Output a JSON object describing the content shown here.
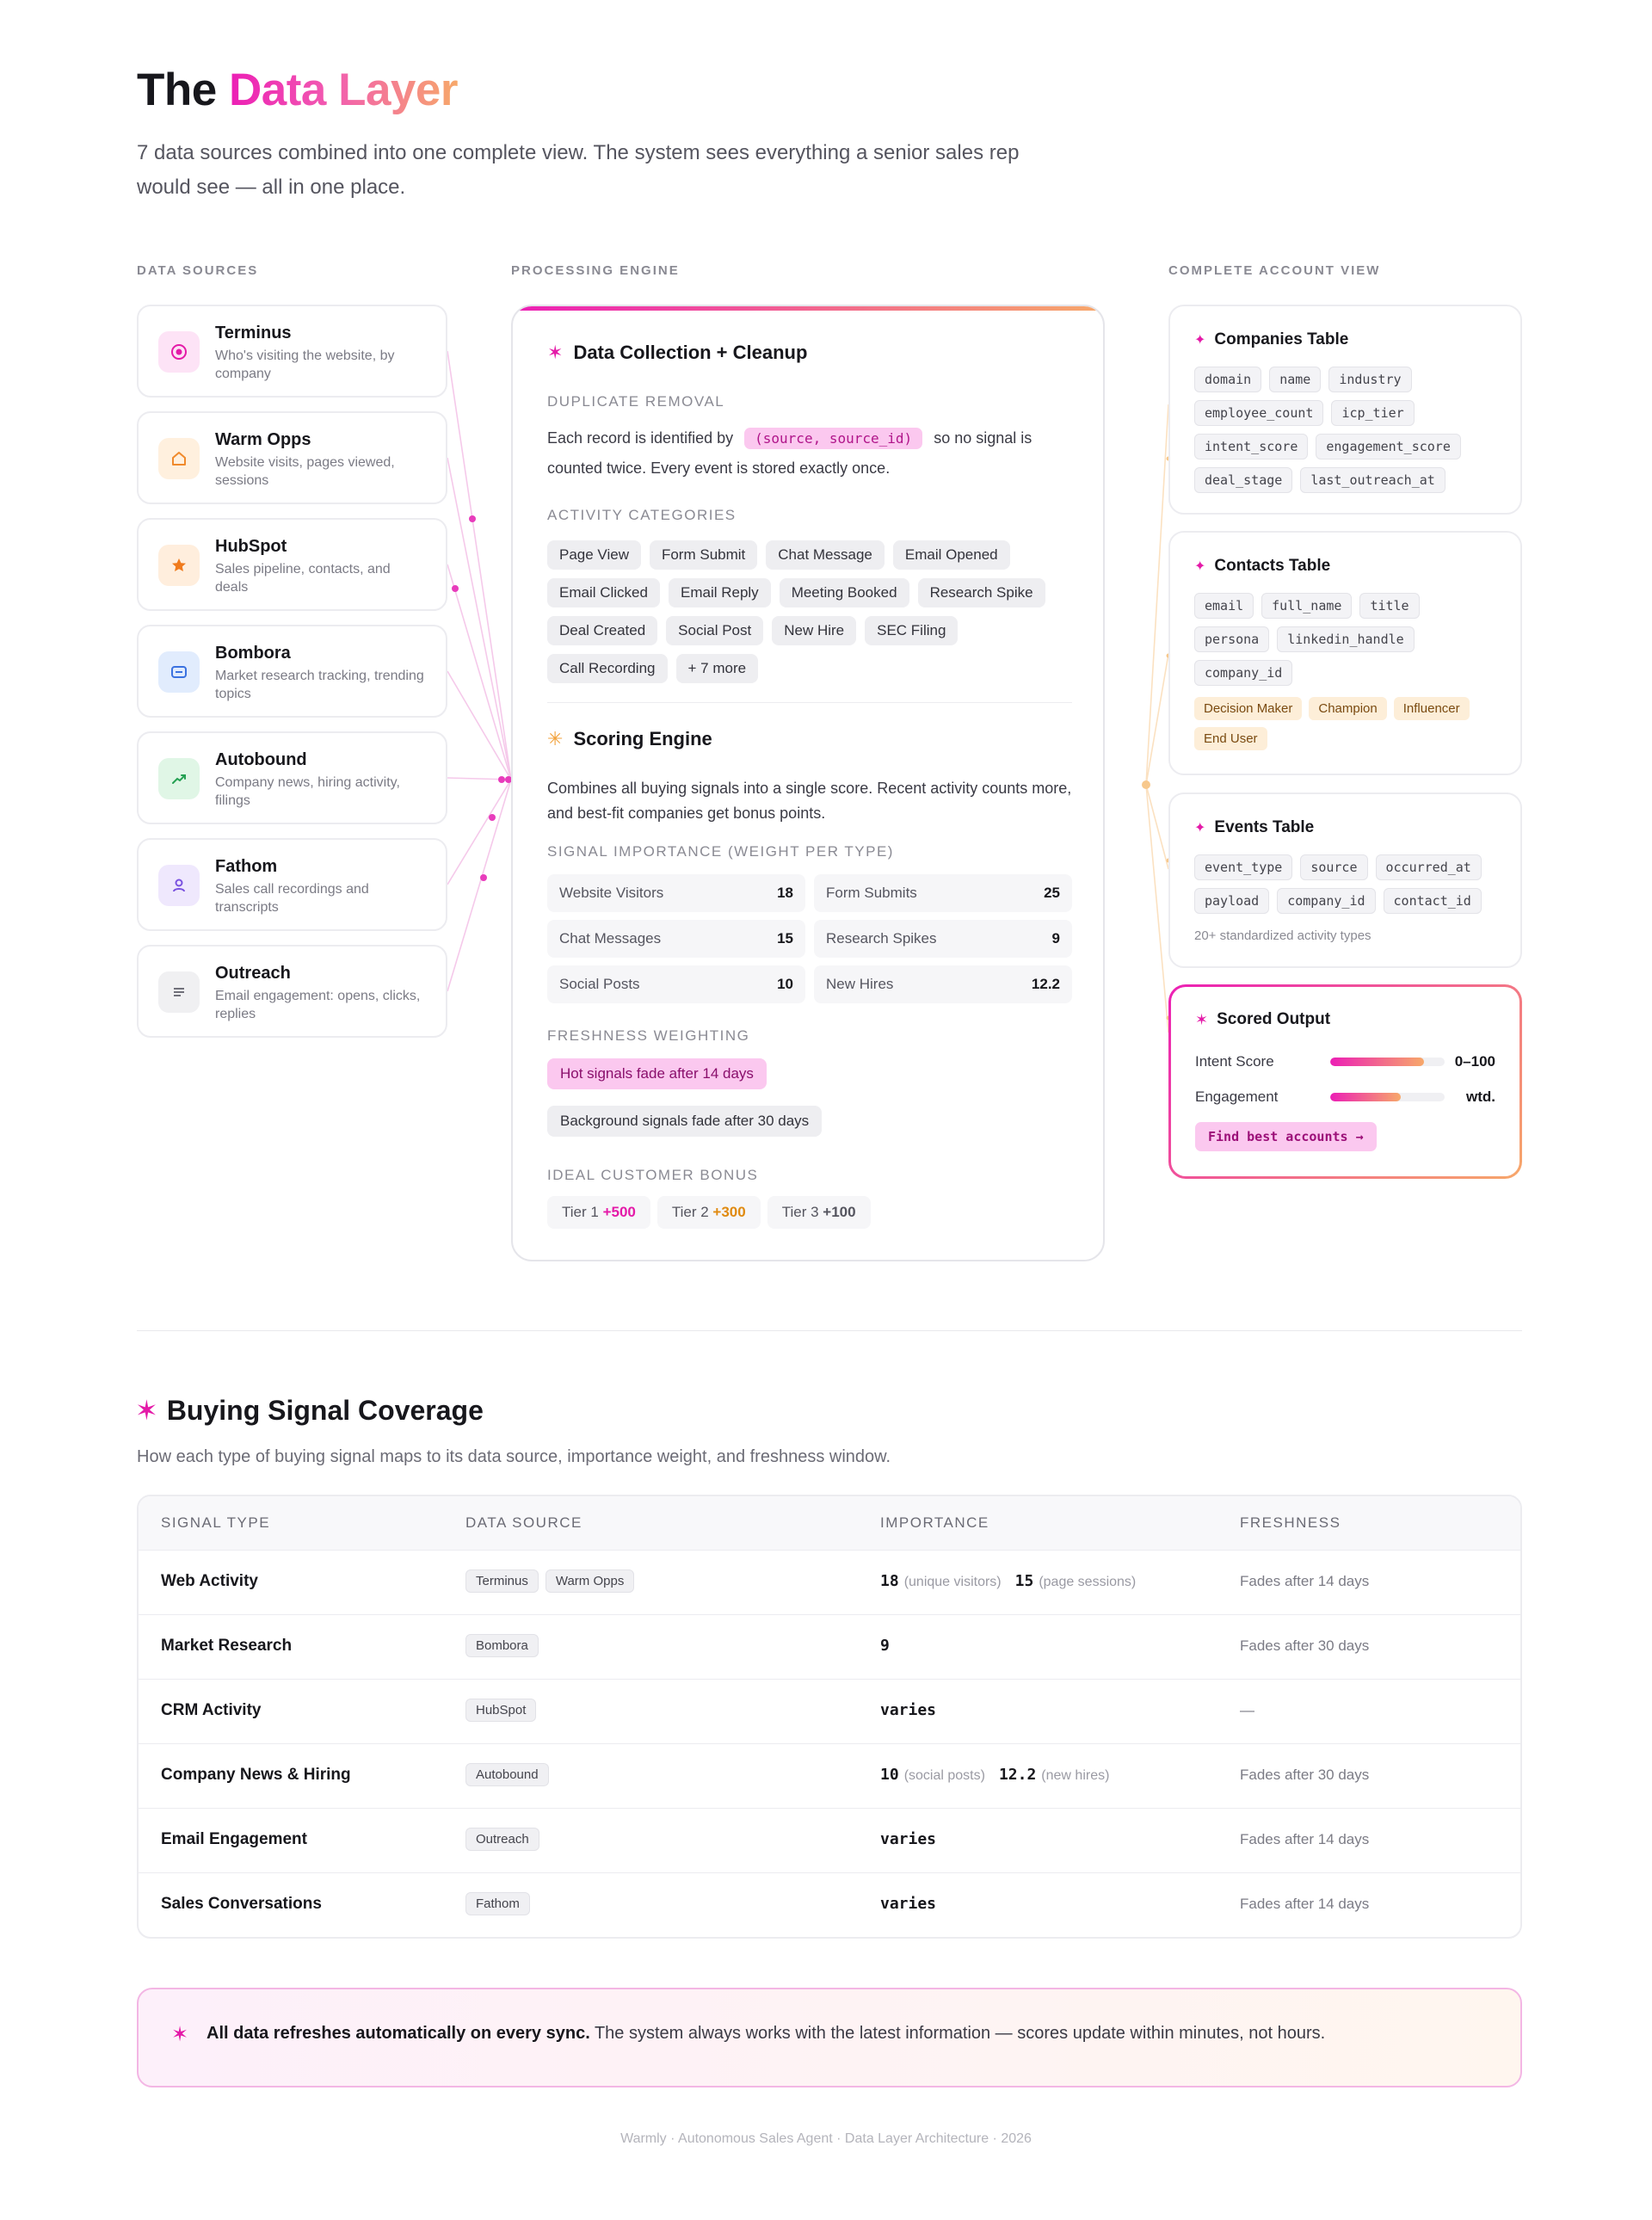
{
  "header": {
    "title_plain": "The",
    "title_accent": "Data Layer",
    "subtitle": "7 data sources combined into one complete view. The system sees everything a senior sales rep would see — all in one place."
  },
  "columns": {
    "sources": "DATA SOURCES",
    "engine": "PROCESSING ENGINE",
    "account": "COMPLETE ACCOUNT VIEW"
  },
  "sources": [
    {
      "name": "Terminus",
      "desc": "Who's visiting the website, by company",
      "icon": "target-icon",
      "bg": "#fde3f6",
      "fg": "#e41aa8"
    },
    {
      "name": "Warm Opps",
      "desc": "Website visits, pages viewed, sessions",
      "icon": "home-icon",
      "bg": "#fff0de",
      "fg": "#f08a2c"
    },
    {
      "name": "HubSpot",
      "desc": "Sales pipeline, contacts, and deals",
      "icon": "star-icon",
      "bg": "#ffeedd",
      "fg": "#f07a1c"
    },
    {
      "name": "Bombora",
      "desc": "Market research tracking, trending topics",
      "icon": "chat-icon",
      "bg": "#e1ecfd",
      "fg": "#3b72e0"
    },
    {
      "name": "Autobound",
      "desc": "Company news, hiring activity, filings",
      "icon": "trend-icon",
      "bg": "#e0f6e6",
      "fg": "#24a052"
    },
    {
      "name": "Fathom",
      "desc": "Sales call recordings and transcripts",
      "icon": "user-icon",
      "bg": "#efe8fd",
      "fg": "#7a52e0"
    },
    {
      "name": "Outreach",
      "desc": "Email engagement: opens, clicks, replies",
      "icon": "lines-icon",
      "bg": "#f0f0f2",
      "fg": "#70707a"
    }
  ],
  "engine": {
    "collection_title": "Data Collection + Cleanup",
    "dup_label": "DUPLICATE REMOVAL",
    "dup_text_1": "Each record is identified by",
    "dup_key": "(source, source_id)",
    "dup_text_2": "so no signal is counted twice. Every event is stored exactly once.",
    "activity_label": "ACTIVITY CATEGORIES",
    "activities": [
      "Page View",
      "Form Submit",
      "Chat Message",
      "Email Opened",
      "Email Clicked",
      "Email Reply",
      "Meeting Booked",
      "Research Spike",
      "Deal Created",
      "Social Post",
      "New Hire",
      "SEC Filing",
      "Call Recording",
      "+ 7 more"
    ],
    "scoring_title": "Scoring Engine",
    "scoring_text": "Combines all buying signals into a single score. Recent activity counts more, and best-fit companies get bonus points.",
    "weights_label": "SIGNAL IMPORTANCE (WEIGHT PER TYPE)",
    "weights": [
      {
        "label": "Website Visitors",
        "value": "18"
      },
      {
        "label": "Form Submits",
        "value": "25"
      },
      {
        "label": "Chat Messages",
        "value": "15"
      },
      {
        "label": "Research Spikes",
        "value": "9"
      },
      {
        "label": "Social Posts",
        "value": "10"
      },
      {
        "label": "New Hires",
        "value": "12.2"
      }
    ],
    "fresh_label": "FRESHNESS WEIGHTING",
    "fresh_hot": "Hot signals fade after 14 days",
    "fresh_bg": "Background signals fade after 30 days",
    "icp_label": "IDEAL CUSTOMER BONUS",
    "tiers": [
      {
        "label": "Tier 1",
        "bonus": "+500",
        "color": "#e41aa8"
      },
      {
        "label": "Tier 2",
        "bonus": "+300",
        "color": "#e08a10"
      },
      {
        "label": "Tier 3",
        "bonus": "+100",
        "color": "#55555f"
      }
    ]
  },
  "tables": {
    "companies": {
      "title": "Companies Table",
      "fields": [
        "domain",
        "name",
        "industry",
        "employee_count",
        "icp_tier",
        "intent_score",
        "engagement_score",
        "deal_stage",
        "last_outreach_at"
      ]
    },
    "contacts": {
      "title": "Contacts Table",
      "fields": [
        "email",
        "full_name",
        "title",
        "persona",
        "linkedin_handle",
        "company_id"
      ],
      "roles": [
        "Decision Maker",
        "Champion",
        "Influencer",
        "End User"
      ]
    },
    "events": {
      "title": "Events Table",
      "fields": [
        "event_type",
        "source",
        "occurred_at",
        "payload",
        "company_id",
        "contact_id"
      ],
      "note": "20+ standardized activity types"
    }
  },
  "scored": {
    "title": "Scored Output",
    "intent_label": "Intent Score",
    "intent_value": "0–100",
    "intent_level": 0.82,
    "engagement_label": "Engagement",
    "engagement_value": "wtd.",
    "engagement_level": 0.62,
    "button": "Find best accounts →"
  },
  "coverage": {
    "title": "Buying Signal Coverage",
    "subtitle": "How each type of buying signal maps to its data source, importance weight, and freshness window.",
    "headers": [
      "SIGNAL TYPE",
      "DATA SOURCE",
      "IMPORTANCE",
      "FRESHNESS"
    ],
    "rows": [
      {
        "type": "Web Activity",
        "sources": [
          "Terminus",
          "Warm Opps"
        ],
        "importance": [
          {
            "n": "18",
            "q": "(unique visitors)"
          },
          {
            "n": "15",
            "q": "(page sessions)"
          }
        ],
        "fresh": "Fades after 14 days"
      },
      {
        "type": "Market Research",
        "sources": [
          "Bombora"
        ],
        "importance": [
          {
            "n": "9",
            "q": ""
          }
        ],
        "fresh": "Fades after 30 days"
      },
      {
        "type": "CRM Activity",
        "sources": [
          "HubSpot"
        ],
        "importance": [
          {
            "n": "varies",
            "q": ""
          }
        ],
        "fresh": "—"
      },
      {
        "type": "Company News & Hiring",
        "sources": [
          "Autobound"
        ],
        "importance": [
          {
            "n": "10",
            "q": "(social posts)"
          },
          {
            "n": "12.2",
            "q": "(new hires)"
          }
        ],
        "fresh": "Fades after 30 days"
      },
      {
        "type": "Email Engagement",
        "sources": [
          "Outreach"
        ],
        "importance": [
          {
            "n": "varies",
            "q": ""
          }
        ],
        "fresh": "Fades after 14 days"
      },
      {
        "type": "Sales Conversations",
        "sources": [
          "Fathom"
        ],
        "importance": [
          {
            "n": "varies",
            "q": ""
          }
        ],
        "fresh": "Fades after 14 days"
      }
    ]
  },
  "banner": {
    "bold": "All data refreshes automatically on every sync.",
    "text": " The system always works with the latest information — scores update within minutes, not hours."
  },
  "footer": "Warmly · Autonomous Sales Agent · Data Layer Architecture · 2026",
  "colors": {
    "accent": "#e41aa8",
    "accent_warm": "#f7a86a"
  }
}
